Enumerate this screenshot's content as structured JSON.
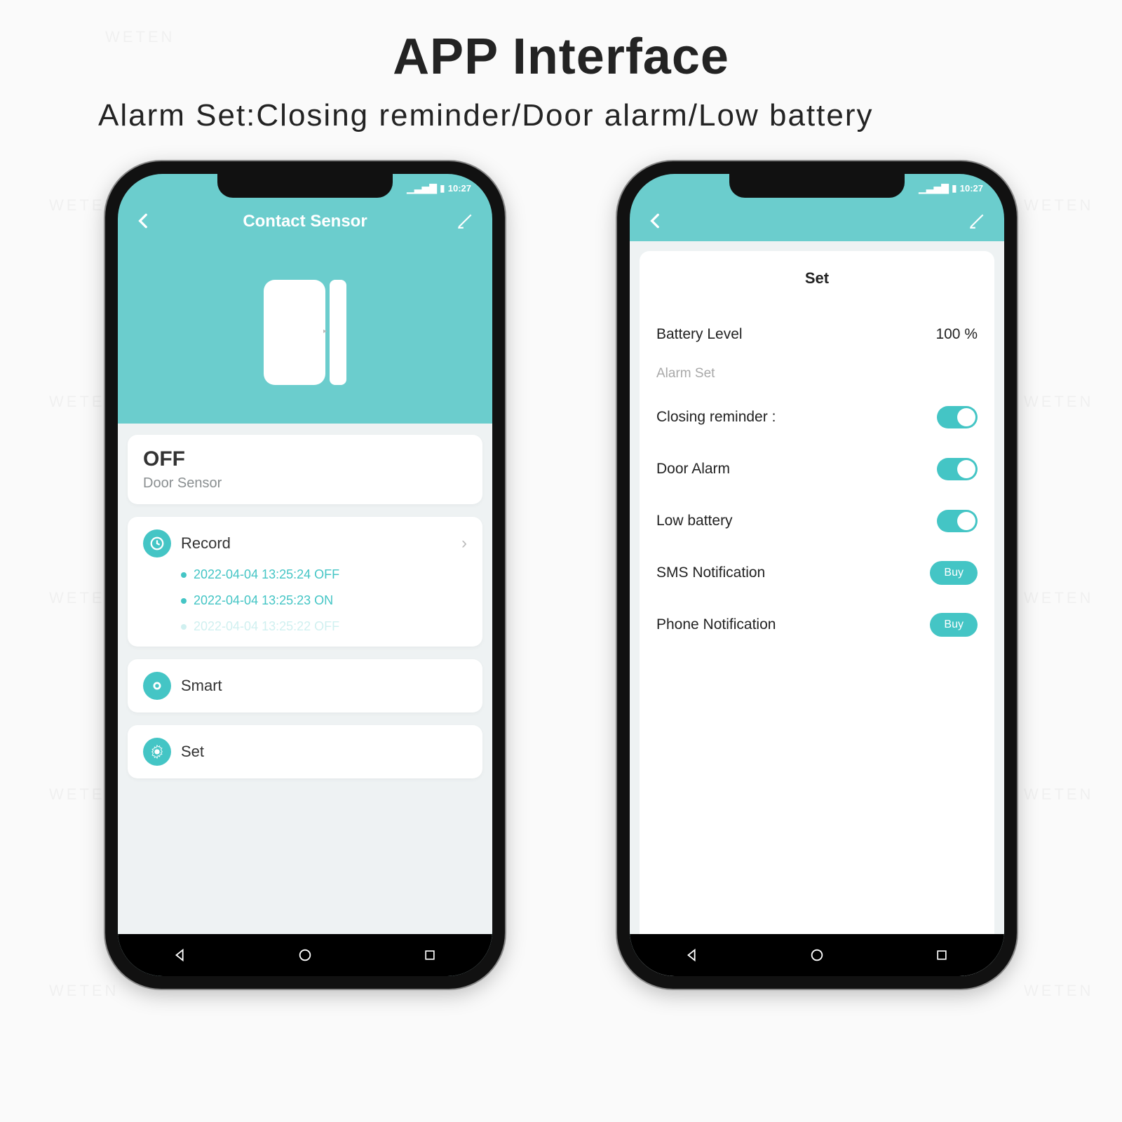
{
  "page": {
    "title": "APP Interface",
    "subtitle": "Alarm Set:Closing reminder/Door alarm/Low battery",
    "watermark": "WETEN"
  },
  "status_bar": {
    "time": "10:27"
  },
  "left": {
    "header_title": "Contact Sensor",
    "status_value": "OFF",
    "status_label": "Door Sensor",
    "record_label": "Record",
    "records": [
      "2022-04-04 13:25:24 OFF",
      "2022-04-04 13:25:23 ON",
      "2022-04-04 13:25:22 OFF"
    ],
    "smart_label": "Smart",
    "set_label": "Set"
  },
  "right": {
    "panel_title": "Set",
    "battery_label": "Battery Level",
    "battery_value": "100 %",
    "section": "Alarm Set",
    "rows": {
      "closing": "Closing reminder :",
      "door": "Door Alarm",
      "low": "Low battery",
      "sms": "SMS Notification",
      "phone": "Phone Notification"
    },
    "buy": "Buy"
  }
}
